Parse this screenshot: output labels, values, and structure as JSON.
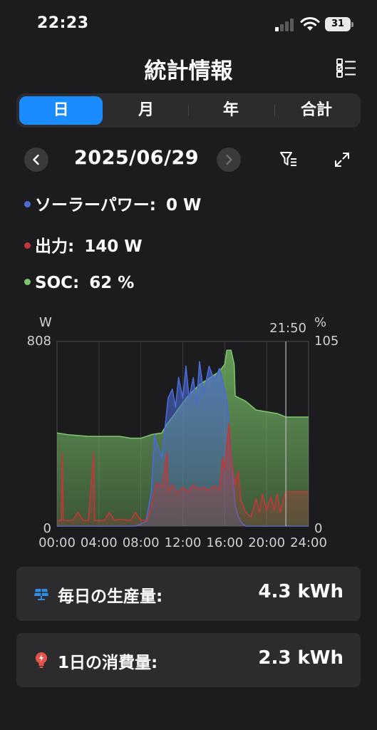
{
  "status": {
    "time": "22:23",
    "battery": "31"
  },
  "header": {
    "title": "統計情報"
  },
  "tabs": [
    {
      "label": "日",
      "active": true
    },
    {
      "label": "月",
      "active": false
    },
    {
      "label": "年",
      "active": false
    },
    {
      "label": "合計",
      "active": false
    }
  ],
  "date_nav": {
    "date": "2025/06/29"
  },
  "metrics": {
    "solar": {
      "label": "ソーラーパワー:",
      "value": "0 W",
      "color": "#4a6bd6"
    },
    "output": {
      "label": "出力:",
      "value": "140 W",
      "color": "#c2383a"
    },
    "soc": {
      "label": "SOC:",
      "value": "62 %",
      "color": "#7cc46a"
    }
  },
  "chart_data": {
    "type": "area",
    "left_unit": "W",
    "right_unit": "%",
    "cursor_time": "21:50",
    "y_left": {
      "min": 0,
      "max": 808,
      "tick_labels": [
        "808",
        "0"
      ]
    },
    "y_right": {
      "min": 0,
      "max": 105,
      "tick_labels": [
        "105",
        "0"
      ]
    },
    "x_ticks": [
      "00:00",
      "04:00",
      "08:00",
      "12:00",
      "16:00",
      "20:00",
      "24:00"
    ],
    "x_range_hours": [
      0,
      24
    ],
    "series": [
      {
        "axis": "left",
        "color": "#4a6bd6",
        "points": [
          [
            0,
            0
          ],
          [
            6,
            0
          ],
          [
            7.5,
            0
          ],
          [
            8.5,
            20
          ],
          [
            9,
            150
          ],
          [
            9.3,
            400
          ],
          [
            9.6,
            350
          ],
          [
            10,
            300
          ],
          [
            10.3,
            430
          ],
          [
            10.6,
            560
          ],
          [
            11,
            600
          ],
          [
            11.3,
            520
          ],
          [
            11.6,
            650
          ],
          [
            12,
            560
          ],
          [
            12.3,
            700
          ],
          [
            12.6,
            560
          ],
          [
            13,
            650
          ],
          [
            13.3,
            530
          ],
          [
            13.6,
            720
          ],
          [
            14,
            580
          ],
          [
            14.5,
            700
          ],
          [
            15,
            640
          ],
          [
            15.5,
            690
          ],
          [
            16,
            600
          ],
          [
            16.3,
            520
          ],
          [
            16.5,
            380
          ],
          [
            16.8,
            200
          ],
          [
            17,
            90
          ],
          [
            17.3,
            40
          ],
          [
            17.6,
            15
          ],
          [
            18,
            0
          ],
          [
            24,
            0
          ]
        ]
      },
      {
        "axis": "left",
        "color": "#c2383a",
        "points": [
          [
            0,
            25
          ],
          [
            0.4,
            25
          ],
          [
            0.5,
            320
          ],
          [
            0.6,
            25
          ],
          [
            1.5,
            25
          ],
          [
            2,
            60
          ],
          [
            2.5,
            25
          ],
          [
            3,
            25
          ],
          [
            3.5,
            320
          ],
          [
            3.6,
            25
          ],
          [
            4.5,
            25
          ],
          [
            5,
            60
          ],
          [
            5.5,
            25
          ],
          [
            6,
            30
          ],
          [
            7,
            25
          ],
          [
            7.5,
            60
          ],
          [
            8,
            25
          ],
          [
            8.6,
            25
          ],
          [
            9,
            90
          ],
          [
            9.5,
            190
          ],
          [
            10,
            170
          ],
          [
            10.5,
            320
          ],
          [
            10.6,
            150
          ],
          [
            11,
            180
          ],
          [
            11.5,
            140
          ],
          [
            12,
            170
          ],
          [
            12.5,
            150
          ],
          [
            13,
            180
          ],
          [
            13.5,
            160
          ],
          [
            14,
            170
          ],
          [
            14.5,
            155
          ],
          [
            15,
            175
          ],
          [
            15.5,
            160
          ],
          [
            15.8,
            300
          ],
          [
            16,
            250
          ],
          [
            16.4,
            450
          ],
          [
            16.6,
            300
          ],
          [
            17,
            180
          ],
          [
            17.3,
            240
          ],
          [
            17.5,
            120
          ],
          [
            18,
            60
          ],
          [
            18.5,
            40
          ],
          [
            19,
            120
          ],
          [
            19.3,
            60
          ],
          [
            19.6,
            140
          ],
          [
            20,
            70
          ],
          [
            20.4,
            130
          ],
          [
            20.7,
            70
          ],
          [
            21,
            140
          ],
          [
            21.3,
            60
          ],
          [
            21.6,
            120
          ],
          [
            21.85,
            150
          ],
          [
            24,
            150
          ]
        ]
      },
      {
        "axis": "right",
        "color": "#7cc46a",
        "points": [
          [
            0,
            53
          ],
          [
            1,
            52
          ],
          [
            3,
            51
          ],
          [
            6,
            51
          ],
          [
            7,
            50
          ],
          [
            8,
            50
          ],
          [
            9,
            52
          ],
          [
            10,
            53
          ],
          [
            10.5,
            58
          ],
          [
            11,
            62
          ],
          [
            11.5,
            66
          ],
          [
            12,
            70
          ],
          [
            12.5,
            74
          ],
          [
            13,
            77
          ],
          [
            13.5,
            80
          ],
          [
            14,
            82
          ],
          [
            14.5,
            84
          ],
          [
            15,
            86
          ],
          [
            15.5,
            88
          ],
          [
            16,
            92
          ],
          [
            16.2,
            100
          ],
          [
            16.6,
            100
          ],
          [
            16.9,
            92
          ],
          [
            17,
            74
          ],
          [
            18,
            71
          ],
          [
            19,
            66
          ],
          [
            20,
            65
          ],
          [
            21,
            64
          ],
          [
            21.85,
            62
          ],
          [
            24,
            62
          ]
        ]
      }
    ]
  },
  "cards": {
    "production": {
      "label": "毎日の生産量:",
      "value": "4.3 kWh",
      "icon": "solar-panel-icon"
    },
    "consumption": {
      "label": "1日の消費量:",
      "value": "2.3 kWh",
      "icon": "lightbulb-icon"
    }
  }
}
